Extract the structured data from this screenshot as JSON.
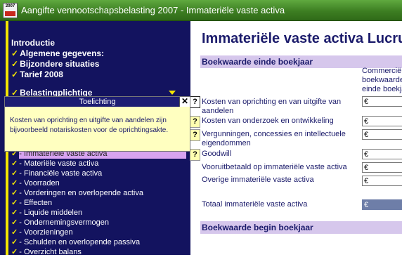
{
  "window": {
    "title": "Aangifte vennootschapsbelasting 2007 - Immateriële vaste activa",
    "icon_text": "2007"
  },
  "sidebar": {
    "top_items": [
      {
        "label": "Introductie",
        "checked": false
      },
      {
        "label": "Algemene gegevens:",
        "checked": true
      },
      {
        "label": "Bijzondere situaties",
        "checked": true
      },
      {
        "label": "Tarief 2008",
        "checked": true
      }
    ],
    "belasting_label": "Belastingplichtige",
    "items": [
      {
        "label": "- Immateriële vaste activa",
        "active": true
      },
      {
        "label": "- Materiële vaste activa",
        "active": false
      },
      {
        "label": "- Financiële vaste activa",
        "active": false
      },
      {
        "label": "- Voorraden",
        "active": false
      },
      {
        "label": "- Vorderingen en overlopende activa",
        "active": false
      },
      {
        "label": "- Effecten",
        "active": false
      },
      {
        "label": "- Liquide middelen",
        "active": false
      },
      {
        "label": "- Ondernemingsvermogen",
        "active": false
      },
      {
        "label": "- Voorzieningen",
        "active": false
      },
      {
        "label": "- Schulden en overlopende passiva",
        "active": false
      },
      {
        "label": "- Overzicht balans",
        "active": false
      }
    ]
  },
  "popup": {
    "title": "Toelichting",
    "close": "✕",
    "text": "Kosten van oprichting en uitgifte van aandelen zijn bijvoorbeeld notariskosten voor de oprichtingsakte."
  },
  "main": {
    "heading": "Immateriële vaste activa Lucru",
    "section1": "Boekwaarde einde boekjaar",
    "column_header": [
      "Commerciële",
      "boekwaarde",
      "einde boekja"
    ],
    "currency": "€",
    "help": "?",
    "rows": [
      {
        "label": "Kosten van oprichting en van uitgifte van aandelen",
        "help": true
      },
      {
        "label": "Kosten van onderzoek en ontwikkeling",
        "help": true
      },
      {
        "label": "Vergunningen, concessies en intellectuele eigendommen",
        "help": true
      },
      {
        "label": "Goodwill",
        "help": true
      },
      {
        "label": "Vooruitbetaald op immateriële vaste activa",
        "help": false
      },
      {
        "label": "Overige immateriële vaste activa",
        "help": false
      }
    ],
    "total_label": "Totaal immateriële vaste activa",
    "section2": "Boekwaarde begin boekjaar"
  }
}
